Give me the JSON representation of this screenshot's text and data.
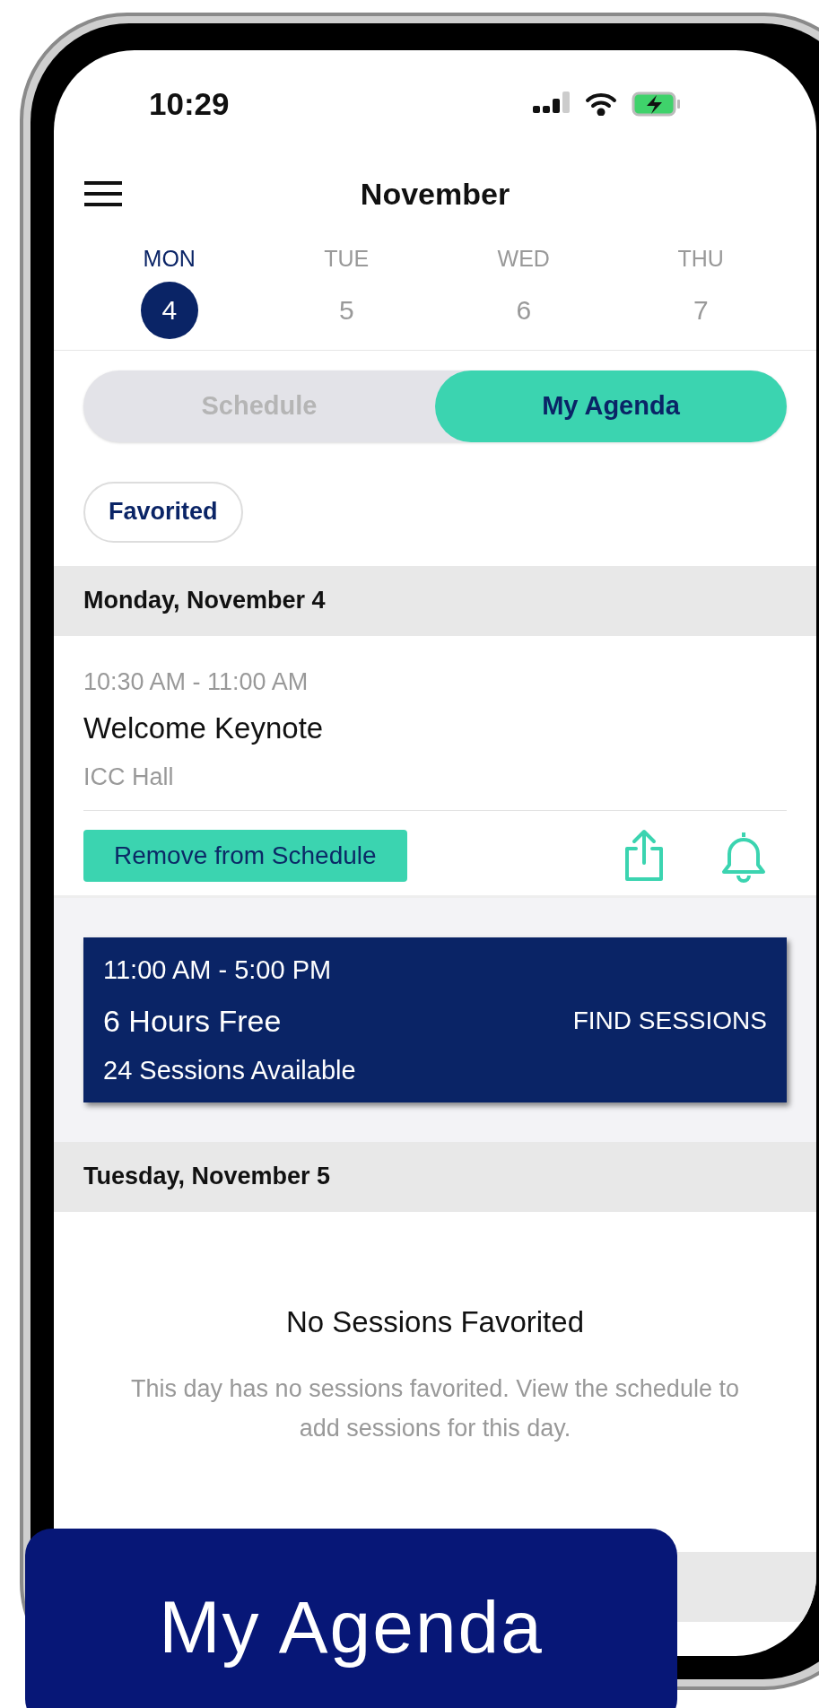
{
  "status_bar": {
    "time": "10:29"
  },
  "header": {
    "title": "November"
  },
  "days": [
    {
      "weekday": "MON",
      "date": "4",
      "selected": true
    },
    {
      "weekday": "TUE",
      "date": "5",
      "selected": false
    },
    {
      "weekday": "WED",
      "date": "6",
      "selected": false
    },
    {
      "weekday": "THU",
      "date": "7",
      "selected": false
    }
  ],
  "tabs": [
    {
      "label": "Schedule",
      "selected": false
    },
    {
      "label": "My Agenda",
      "selected": true
    }
  ],
  "filter": {
    "label": "Favorited"
  },
  "sections": [
    {
      "kind": "day",
      "heading": "Monday, November 4"
    },
    {
      "kind": "session",
      "time": "10:30 AM - 11:00 AM",
      "title": "Welcome Keynote",
      "location": "ICC Hall",
      "action": "Remove from Schedule"
    },
    {
      "kind": "free",
      "time": "11:00 AM - 5:00 PM",
      "title": "6 Hours Free",
      "subtitle": "24 Sessions Available",
      "action": "FIND SESSIONS"
    },
    {
      "kind": "day",
      "heading": "Tuesday, November 5"
    },
    {
      "kind": "empty",
      "title": "No Sessions Favorited",
      "text": "This day has no sessions favorited. View the schedule to add sessions for this day."
    }
  ],
  "caption": "My Agenda"
}
